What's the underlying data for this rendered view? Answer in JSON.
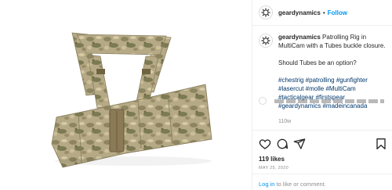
{
  "post": {
    "username": "geardynamics",
    "follow_label": "Follow",
    "header_separator": "•",
    "caption": {
      "text": "Patrolling Rig in MultiCam with a Tubes buckle closure.",
      "question": "Should Tubes be an option?",
      "hashtags": "#chestrig #patrolling #gunfighter #lasercut #molle #MultiCam #tacticalgear #firstspear #geardynamics #madeincanada",
      "time": "110w"
    },
    "likes": "119 likes",
    "date": "MAY 25, 2020",
    "login_link": "Log in",
    "login_rest": " to like or comment."
  },
  "icons": {
    "like": "heart-icon",
    "comment": "comment-icon",
    "share": "share-icon",
    "save": "bookmark-icon",
    "avatar": "gear-logo-icon"
  },
  "colors": {
    "link_blue": "#0095f6",
    "hashtag_blue": "#00376b",
    "multicam_base": "#b9ad88"
  }
}
